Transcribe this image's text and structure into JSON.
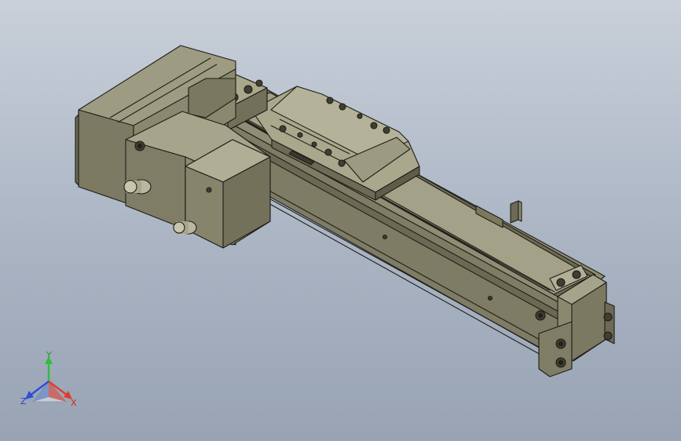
{
  "viewport": {
    "background_top": "#c9d0da",
    "background_bottom": "#98a3b4",
    "model": "linear-actuator-with-side-motor"
  },
  "triad": {
    "x_label": "X",
    "y_label": "Y",
    "z_label": "Z",
    "x_color": "#e23b2e",
    "y_color": "#2fbf3a",
    "z_color": "#2b4fd6"
  },
  "colors": {
    "part_light": "#9c9a80",
    "part_mid": "#8a886f",
    "part_dark": "#6f6d57",
    "part_shadow": "#55533f",
    "edge": "#1e1e18"
  }
}
